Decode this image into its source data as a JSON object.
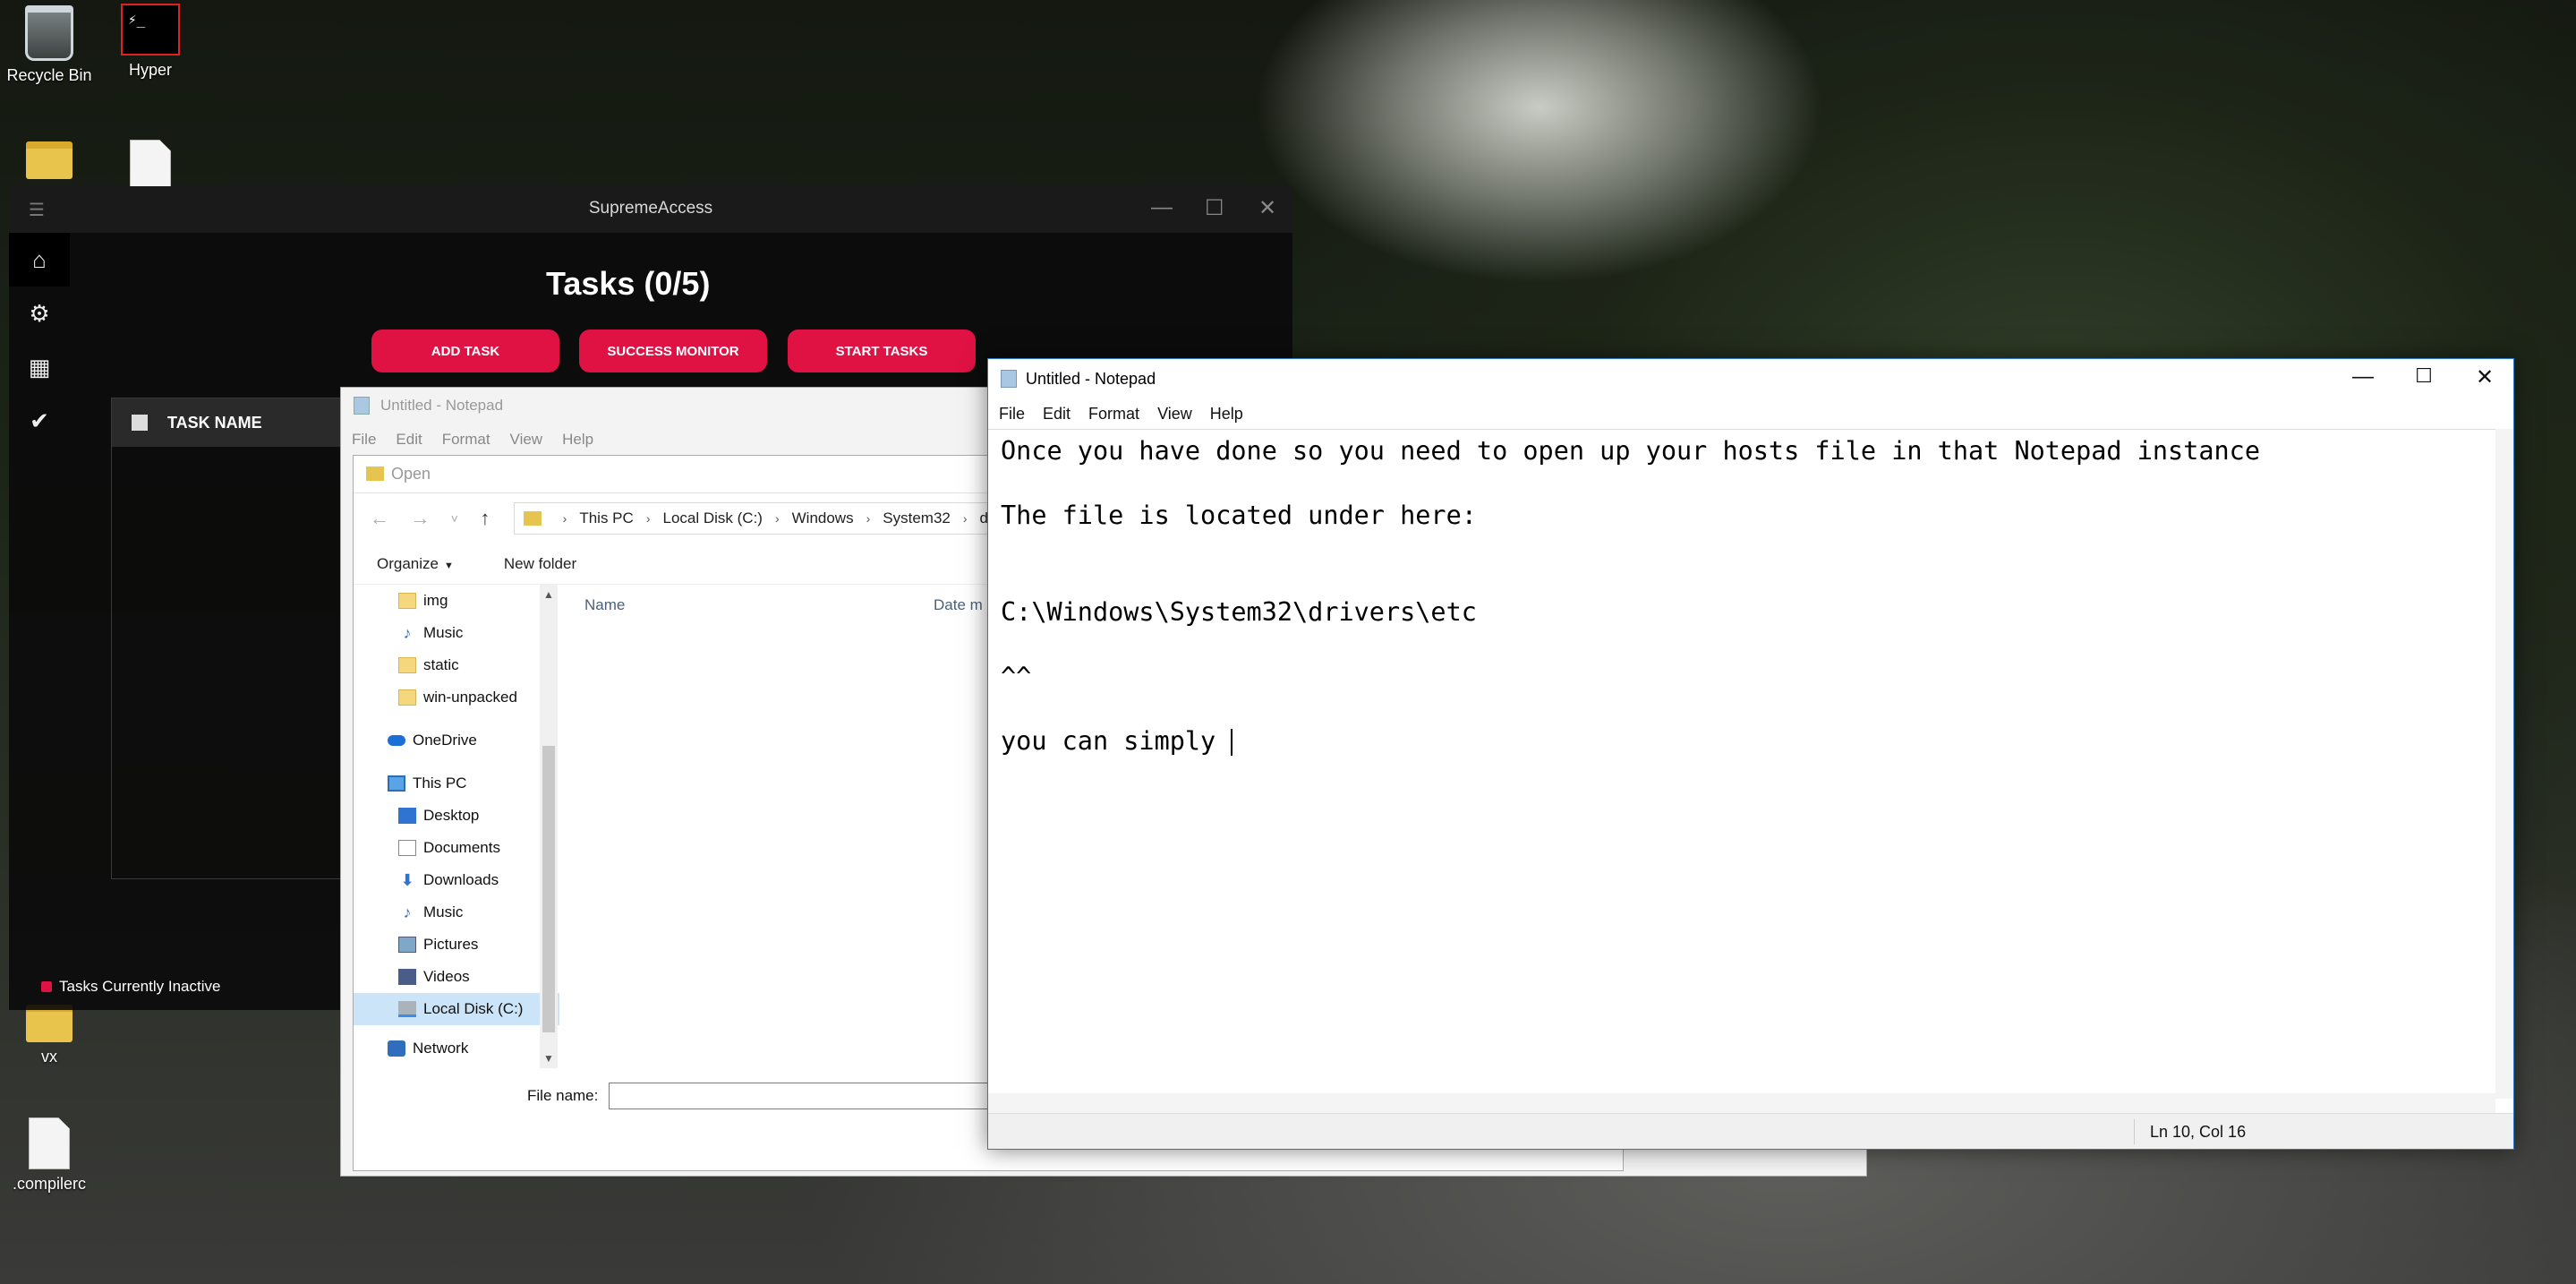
{
  "desktop": {
    "icons": [
      {
        "label": "Recycle Bin",
        "icon": "recycle-bin-icon"
      },
      {
        "label": "Hyper",
        "icon": "hyper-terminal-icon"
      },
      {
        "label": "vx",
        "icon": "folder-icon"
      },
      {
        "label": ".compilerc",
        "icon": "file-icon"
      }
    ]
  },
  "supreme": {
    "title": "SupremeAccess",
    "heading": "Tasks (0/5)",
    "buttons": [
      "ADD TASK",
      "SUCCESS MONITOR",
      "START TASKS"
    ],
    "table_header": "TASK NAME",
    "status": "Tasks Currently Inactive",
    "accent": "#e01244"
  },
  "bg_notepad": {
    "title": "Untitled - Notepad",
    "menu": [
      "File",
      "Edit",
      "Format",
      "View",
      "Help"
    ]
  },
  "open_dialog": {
    "title": "Open",
    "breadcrumbs": [
      "This PC",
      "Local Disk (C:)",
      "Windows",
      "System32",
      "driv"
    ],
    "organize": "Organize",
    "new_folder": "New folder",
    "tree": [
      {
        "label": "img",
        "icon": "folder-icon"
      },
      {
        "label": "Music",
        "icon": "music-icon"
      },
      {
        "label": "static",
        "icon": "folder-icon"
      },
      {
        "label": "win-unpacked",
        "icon": "folder-icon"
      },
      {
        "label": "OneDrive",
        "icon": "onedrive-icon"
      },
      {
        "label": "This PC",
        "icon": "pc-icon"
      },
      {
        "label": "Desktop",
        "icon": "desktop-icon"
      },
      {
        "label": "Documents",
        "icon": "documents-icon"
      },
      {
        "label": "Downloads",
        "icon": "downloads-icon"
      },
      {
        "label": "Music",
        "icon": "music-icon"
      },
      {
        "label": "Pictures",
        "icon": "pictures-icon"
      },
      {
        "label": "Videos",
        "icon": "videos-icon"
      },
      {
        "label": "Local Disk (C:)",
        "icon": "disk-icon"
      },
      {
        "label": "Network",
        "icon": "network-icon"
      }
    ],
    "columns": [
      "Name",
      "Date m"
    ],
    "file_name_label": "File name:",
    "file_name_value": ""
  },
  "notepad": {
    "title": "Untitled - Notepad",
    "menu": [
      "File",
      "Edit",
      "Format",
      "View",
      "Help"
    ],
    "lines": [
      "Once you have done so you need to open up your hosts file in that Notepad instance",
      "",
      "The file is located under here:",
      "",
      "",
      "C:\\Windows\\System32\\drivers\\etc",
      "",
      "^^",
      "",
      "you can simply "
    ],
    "status": "Ln 10, Col 16"
  }
}
